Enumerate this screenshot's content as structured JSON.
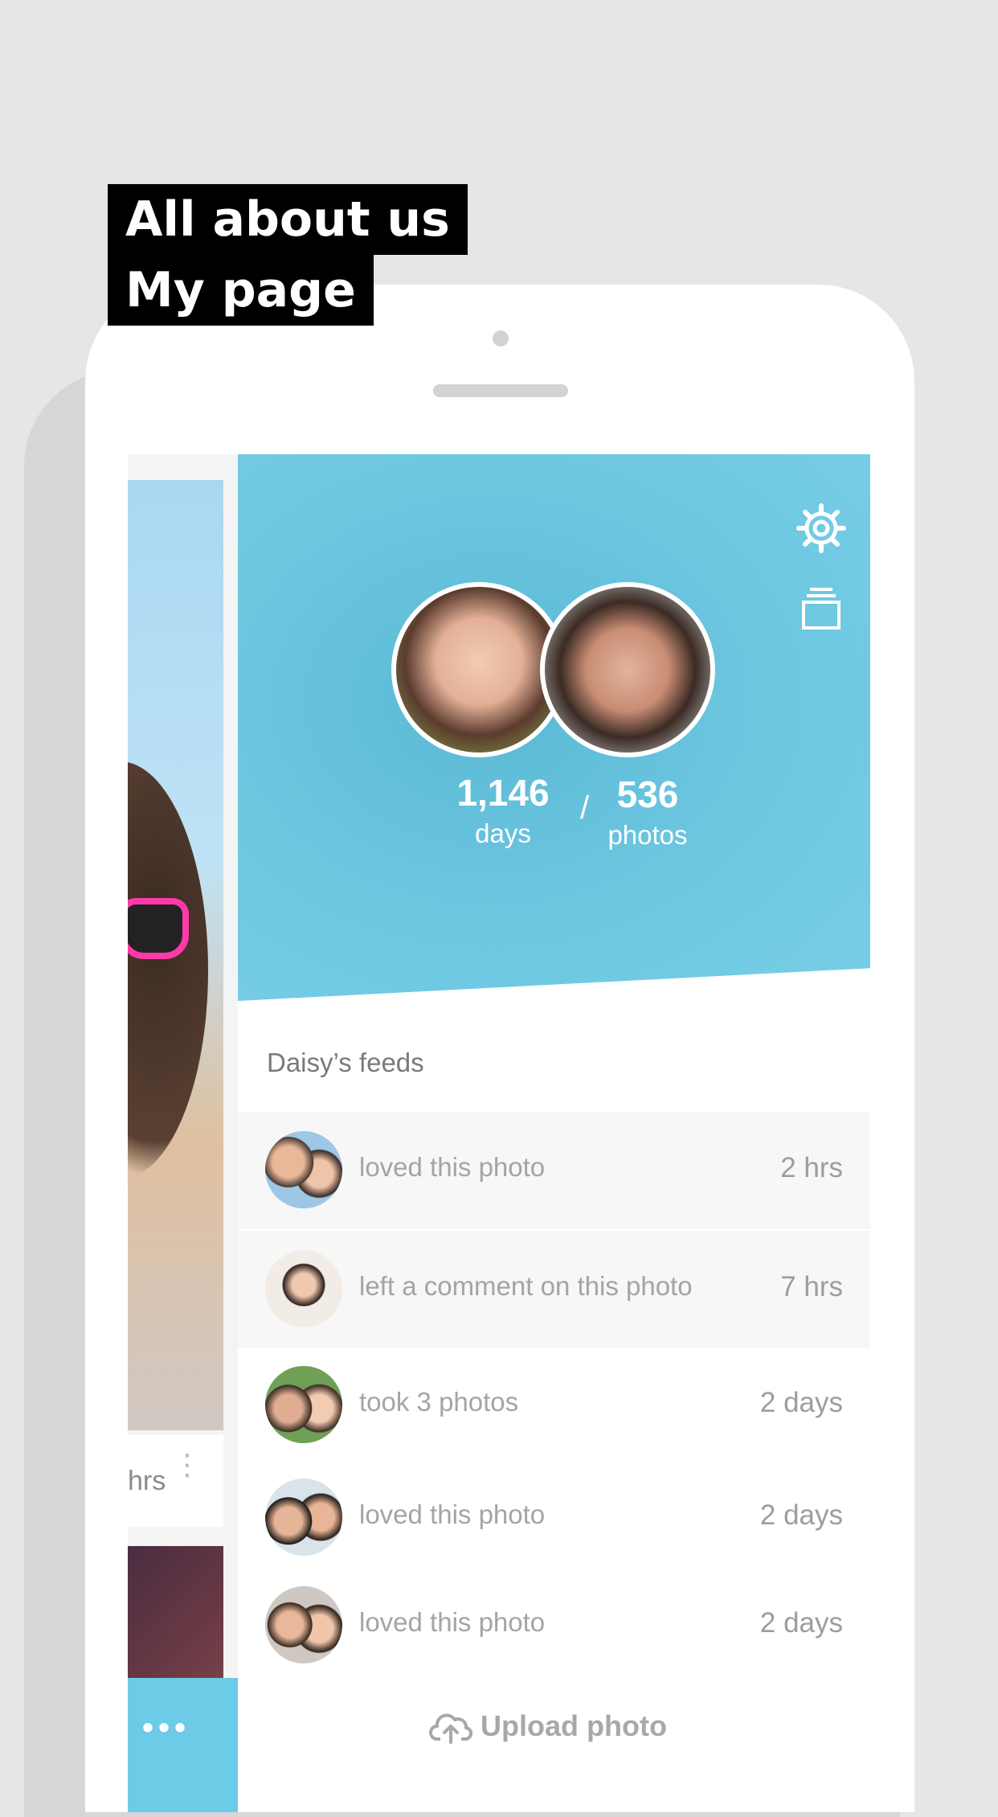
{
  "caption": {
    "line1": "All about us",
    "line2": "My page"
  },
  "background_card": {
    "time_partial": "hrs",
    "more_label": "•••"
  },
  "profile": {
    "days": "1,146",
    "days_label": "days",
    "separator": "/",
    "photos": "536",
    "photos_label": "photos"
  },
  "icons": {
    "settings": "gear-icon",
    "album": "stack-icon",
    "upload": "cloud-upload-icon"
  },
  "feeds": {
    "title": "Daisy’s feeds",
    "items": [
      {
        "text": "loved this photo",
        "time": "2 hrs"
      },
      {
        "text": "left a comment on this photo",
        "time": "7 hrs"
      },
      {
        "text": "took 3 photos",
        "time": "2 days"
      },
      {
        "text": "loved this photo",
        "time": "2 days"
      },
      {
        "text": "loved this photo",
        "time": "2 days"
      }
    ]
  },
  "upload": {
    "label": "Upload photo"
  },
  "colors": {
    "header": "#6cc6e0",
    "caption_bg": "#000000",
    "page_bg": "#e6e6e6"
  }
}
